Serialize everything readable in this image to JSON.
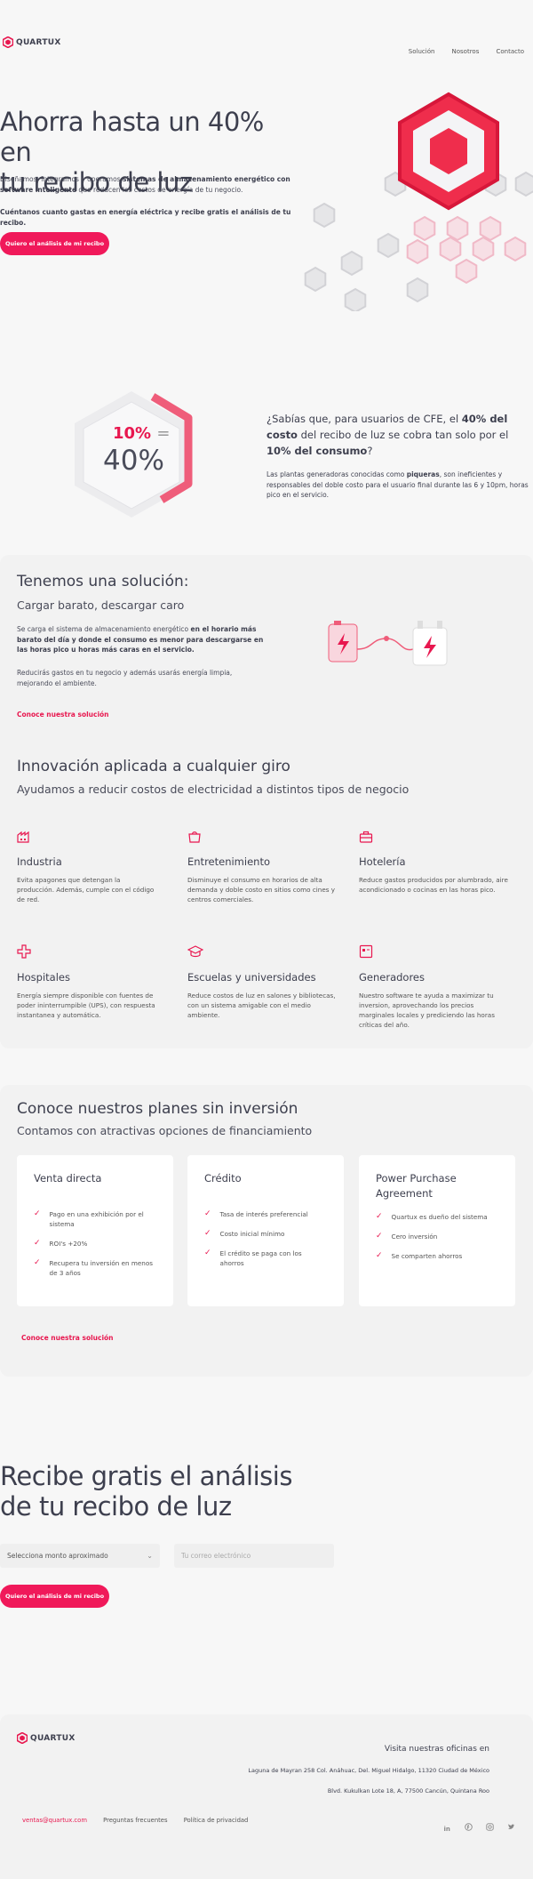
{
  "header": {
    "brand": "QUARTUX",
    "nav": [
      "Solución",
      "Nosotros",
      "Contacto"
    ]
  },
  "hero": {
    "title_line1": "Ahorra hasta un 40% en",
    "title_line2": "tu recibo de luz",
    "desc_a": "Diseñamos, integramos y operamos ",
    "desc_b": "sistemas de almacenamiento energético con software inteligente",
    "desc_c": " que reducen los costos de energía de tu negocio.",
    "desc2": "Cuéntanos cuanto gastas en energía eléctrica y recibe gratis el análisis de tu recibo.",
    "cta": "Quiero el análisis de mi recibo"
  },
  "fact": {
    "small_pct": "10%",
    "eq": "=",
    "big_pct": "40%",
    "q_a": "¿Sabías que, para usuarios de CFE, el ",
    "q_b": "40% del costo",
    "q_c": " del recibo de luz se cobra tan solo por el ",
    "q_d": "10% del consumo",
    "q_e": "?",
    "p_a": "Las plantas generadoras conocidas como ",
    "p_b": "piqueras",
    "p_c": ", son ineficientes y responsables del doble costo para el usuario final durante las 6 y 10pm, horas pico en el servicio."
  },
  "solution": {
    "title": "Tenemos una solución:",
    "subtitle": "Cargar barato, descargar caro",
    "p1_a": "Se carga el sistema de almacenamiento energético ",
    "p1_b": "en el horario más barato del día y donde el consumo es menor para descargarse en las horas pico u horas más caras en el servicio.",
    "p2": "Reducirás gastos en tu negocio y además usarás energía limpia, mejorando el ambiente.",
    "link": "Conoce nuestra solución"
  },
  "innovation": {
    "title": "Innovación aplicada a cualquier giro",
    "subtitle": "Ayudamos a reducir costos de electricidad a distintos tipos de negocio",
    "items": [
      {
        "icon": "factory-icon",
        "title": "Industria",
        "text": "Evita apagones que detengan la producción. Además, cumple con el código de red."
      },
      {
        "icon": "shopping-bag-icon",
        "title": "Entretenimiento",
        "text": "Disminuye el consumo en horarios de alta demanda y doble costo en sitios como cines y centros comerciales."
      },
      {
        "icon": "briefcase-icon",
        "title": "Hotelería",
        "text": "Reduce gastos producidos por alumbrado, aire acondicionado o cocinas en las horas pico."
      },
      {
        "icon": "cross-icon",
        "title": "Hospitales",
        "text": "Energía siempre disponible con fuentes de poder ininterrumpible (UPS), con respuesta instantanea y automática."
      },
      {
        "icon": "graduation-cap-icon",
        "title": "Escuelas y universidades",
        "text": "Reduce costos de luz en salones y bibliotecas, con un sistema amigable con el medio ambiente."
      },
      {
        "icon": "generator-icon",
        "title": "Generadores",
        "text": "Nuestro software te ayuda a maximizar tu inversion, aprovechando los precios marginales locales y prediciendo las horas críticas del año."
      }
    ]
  },
  "plans": {
    "title": "Conoce nuestros planes sin inversión",
    "subtitle": "Contamos con atractivas opciones de financiamiento",
    "items": [
      {
        "title": "Venta directa",
        "bullets": [
          "Pago en una exhibición por el sistema",
          "ROI's +20%",
          "Recupera tu inversión en menos de 3 años"
        ]
      },
      {
        "title": "Crédito",
        "bullets": [
          "Tasa de interés preferencial",
          "Costo inicial mínimo",
          "El crédito se paga con los ahorros"
        ]
      },
      {
        "title": "Power Purchase Agreement",
        "bullets": [
          "Quartux es dueño del sistema",
          "Cero inversión",
          "Se comparten ahorros"
        ]
      }
    ],
    "link": "Conoce nuestra solución"
  },
  "analysis": {
    "title_line1": "Recibe gratis el análisis",
    "title_line2": "de tu recibo de luz",
    "select_value": "Selecciona monto aproximado",
    "email_placeholder": "Tu correo electrónico",
    "cta": "Quiero el análisis de mi recibo"
  },
  "footer": {
    "brand": "QUARTUX",
    "visit": "Visita nuestras oficinas en",
    "address1": "Laguna de Mayran 258 Col. Anáhuac, Del. Miguel Hidalgo, 11320 Ciudad de México",
    "address2": "Blvd. Kukulkan Lote 18, A, 77500 Cancún, Quintana Roo",
    "email": "ventas@quartux.com",
    "faq": "Preguntas frecuentes",
    "privacy": "Política de privacidad",
    "social": [
      "linkedin-icon",
      "facebook-icon",
      "instagram-icon",
      "twitter-icon"
    ]
  },
  "colors": {
    "accent": "#f0195a",
    "text": "#3d3f4e",
    "bg": "#f7f7f7",
    "card": "#f2f2f2"
  }
}
